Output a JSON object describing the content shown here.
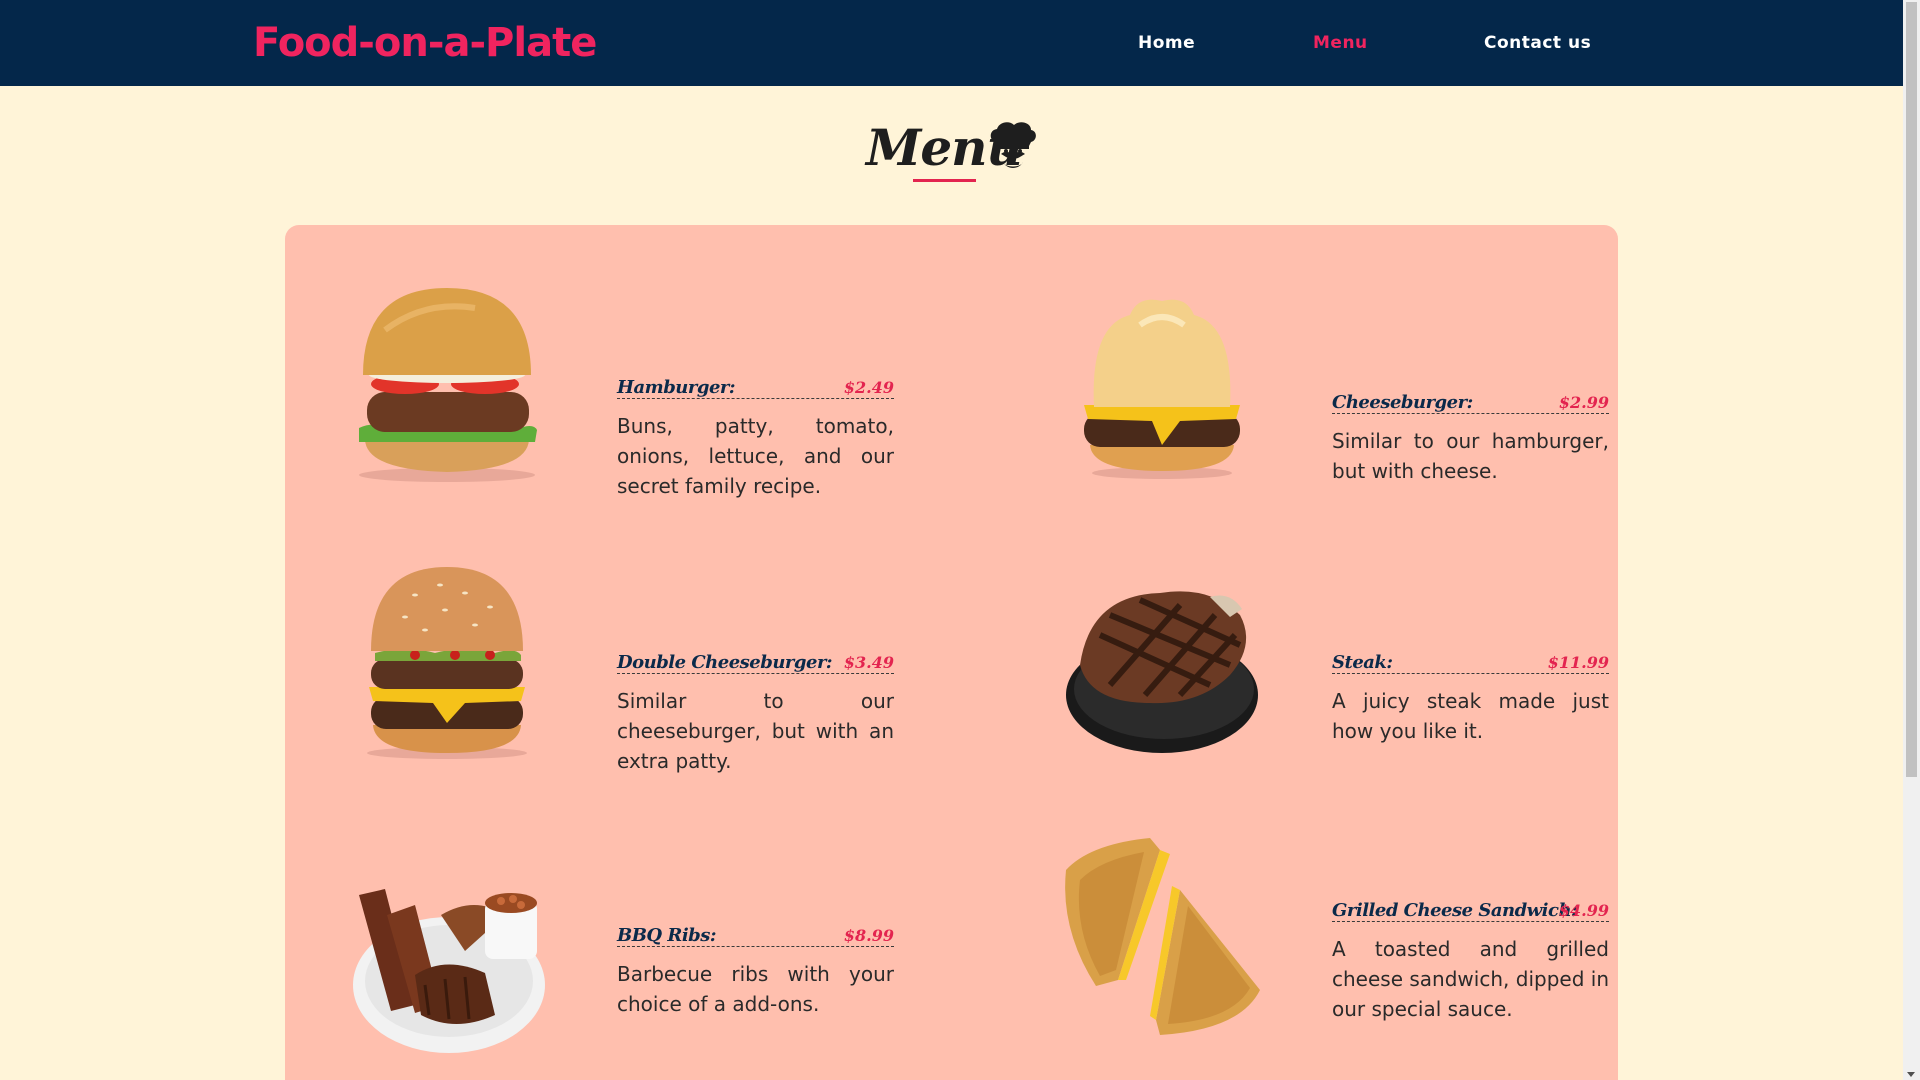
{
  "header": {
    "brand": "Food-on-a-Plate",
    "nav": [
      {
        "label": "Home"
      },
      {
        "label": "Menu",
        "active": true
      },
      {
        "label": "Contact us"
      }
    ]
  },
  "page": {
    "title": "Menu",
    "title_icon": "chef-hat-mustache-icon"
  },
  "menu": {
    "items": [
      {
        "name": "Hamburger:",
        "price": "$2.49",
        "description": "Buns, patty, tomato, onions, lettuce, and our secret family recipe.",
        "image": "hamburger-image"
      },
      {
        "name": "Cheeseburger:",
        "price": "$2.99",
        "description": "Similar to our hamburger, but with cheese.",
        "image": "cheeseburger-image"
      },
      {
        "name": "Double Cheeseburger:",
        "price": "$3.49",
        "description": "Similar to our cheeseburger, but with an extra patty.",
        "image": "double-cheeseburger-image"
      },
      {
        "name": "Steak:",
        "price": "$11.99",
        "description": "A juicy steak made just how you like it.",
        "image": "steak-image"
      },
      {
        "name": "BBQ Ribs:",
        "price": "$8.99",
        "description": "Barbecue ribs with your choice of a add-ons.",
        "image": "bbq-ribs-image"
      },
      {
        "name": "Grilled Cheese Sandwich:",
        "price": "$4.99",
        "description": "A toasted and grilled cheese sandwich, dipped in our special sauce.",
        "image": "grilled-cheese-image"
      }
    ]
  },
  "colors": {
    "navbar": "#04274a",
    "brand": "#f0245f",
    "page_bg": "#fff4d8",
    "card_bg": "#ffbfae",
    "price": "#e3244f"
  }
}
